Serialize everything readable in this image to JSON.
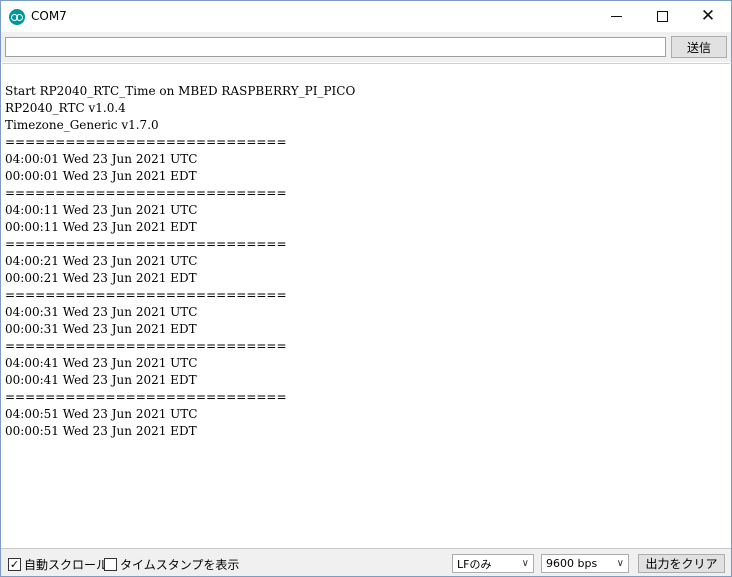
{
  "window": {
    "title": "COM7",
    "icon": "arduino-icon",
    "controls": {
      "minimize": "minimize-icon",
      "maximize": "maximize-icon",
      "close": "close-icon"
    }
  },
  "send": {
    "input_value": "",
    "button_label": "送信"
  },
  "output": {
    "lines": [
      "Start RP2040_RTC_Time on MBED RASPBERRY_PI_PICO",
      "RP2040_RTC v1.0.4",
      "Timezone_Generic v1.7.0",
      "============================",
      "04:00:01 Wed 23 Jun 2021 UTC",
      "00:00:01 Wed 23 Jun 2021 EDT",
      "============================",
      "04:00:11 Wed 23 Jun 2021 UTC",
      "00:00:11 Wed 23 Jun 2021 EDT",
      "============================",
      "04:00:21 Wed 23 Jun 2021 UTC",
      "00:00:21 Wed 23 Jun 2021 EDT",
      "============================",
      "04:00:31 Wed 23 Jun 2021 UTC",
      "00:00:31 Wed 23 Jun 2021 EDT",
      "============================",
      "04:00:41 Wed 23 Jun 2021 UTC",
      "00:00:41 Wed 23 Jun 2021 EDT",
      "============================",
      "04:00:51 Wed 23 Jun 2021 UTC",
      "00:00:51 Wed 23 Jun 2021 EDT"
    ]
  },
  "footer": {
    "autoscroll": {
      "label": "自動スクロール",
      "checked": true
    },
    "timestamp": {
      "label": "タイムスタンプを表示",
      "checked": false
    },
    "line_ending": "LFのみ",
    "baud_rate": "9600 bps",
    "clear_label": "出力をクリア"
  }
}
